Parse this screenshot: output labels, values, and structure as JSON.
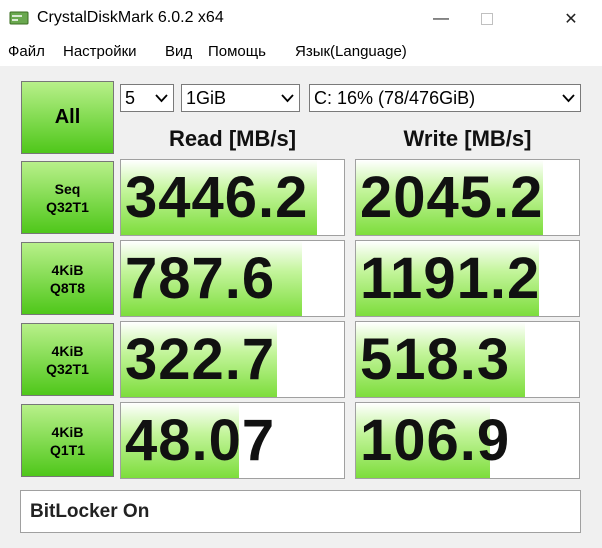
{
  "window": {
    "title": "CrystalDiskMark 6.0.2 x64",
    "minimize_glyph": "—",
    "close_glyph": "✕"
  },
  "menu": [
    "Файл",
    "Настройки",
    "Вид",
    "Помощь",
    "Язык(Language)"
  ],
  "controls": {
    "all_label": "All",
    "count": "5",
    "size": "1GiB",
    "drive": "C: 16% (78/476GiB)"
  },
  "headers": {
    "read": "Read [MB/s]",
    "write": "Write [MB/s]"
  },
  "tests": [
    {
      "label": "Seq\nQ32T1",
      "read": "3446.2",
      "write": "2045.2",
      "read_fill": 0.88,
      "write_fill": 0.84
    },
    {
      "label": "4KiB\nQ8T8",
      "read": "787.6",
      "write": "1191.2",
      "read_fill": 0.81,
      "write_fill": 0.82
    },
    {
      "label": "4KiB\nQ32T1",
      "read": "322.7",
      "write": "518.3",
      "read_fill": 0.7,
      "write_fill": 0.76
    },
    {
      "label": "4KiB\nQ1T1",
      "read": "48.07",
      "write": "106.9",
      "read_fill": 0.53,
      "write_fill": 0.6
    }
  ],
  "comment": "BitLocker On",
  "colors": {
    "bar_green": "#7ddd3c",
    "button_green": "#4fc71a"
  }
}
